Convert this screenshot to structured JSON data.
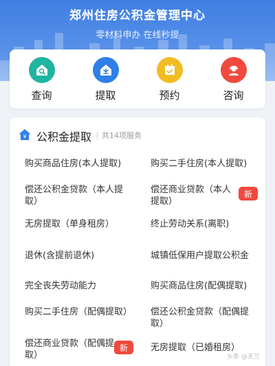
{
  "header": {
    "title": "郑州住房公积金管理中心",
    "subtitle": "零材料申办 在线秒提"
  },
  "quick_actions": [
    {
      "label": "查询",
      "icon": "house-search-icon",
      "color": "#1fb5a1"
    },
    {
      "label": "提取",
      "icon": "house-withdraw-icon",
      "color": "#2f7fe8"
    },
    {
      "label": "预约",
      "icon": "calendar-check-icon",
      "color": "#f2bd23"
    },
    {
      "label": "咨询",
      "icon": "customer-service-icon",
      "color": "#f04a3e"
    }
  ],
  "section": {
    "icon": "house-yuan-icon",
    "title": "公积金提取",
    "count": "共14项服务"
  },
  "services": [
    {
      "label": "购买商品住房(本人提取)",
      "badge": ""
    },
    {
      "label": "购买二手住房(本人提取)",
      "badge": ""
    },
    {
      "label": "偿还公积金贷款（本人提取）",
      "badge": ""
    },
    {
      "label": "偿还商业贷款（本人提取）",
      "badge": "新"
    },
    {
      "label": "无房提取（单身租房）",
      "badge": ""
    },
    {
      "label": "终止劳动关系(离职)",
      "badge": ""
    },
    {
      "label": "退休(含提前退休)",
      "badge": ""
    },
    {
      "label": "城镇低保用户提取公积金",
      "badge": ""
    },
    {
      "label": "完全丧失劳动能力",
      "badge": ""
    },
    {
      "label": "购买商品住房(配偶提取)",
      "badge": ""
    },
    {
      "label": "购买二手住房（配偶提取）",
      "badge": ""
    },
    {
      "label": "偿还公积金贷款（配偶提取）",
      "badge": ""
    },
    {
      "label": "偿还商业贷款（配偶提取）",
      "badge": "新"
    },
    {
      "label": "无房提取（已婚租房）",
      "badge": ""
    }
  ],
  "watermark": "头条 @天兰"
}
